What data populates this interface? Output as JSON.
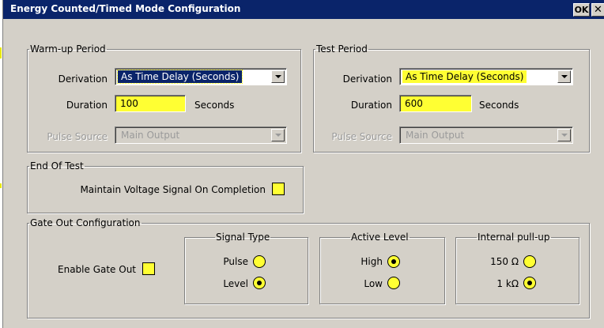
{
  "dialog": {
    "title": "Energy Counted/Timed Mode Configuration",
    "ok_label": "OK",
    "close_label": "✕"
  },
  "warmup": {
    "legend": "Warm-up Period",
    "derivation_label": "Derivation",
    "derivation_value": "As Time Delay (Seconds)",
    "duration_label": "Duration",
    "duration_value": "100",
    "duration_unit": "Seconds",
    "pulse_source_label": "Pulse Source",
    "pulse_source_value": "Main Output"
  },
  "test": {
    "legend": "Test Period",
    "derivation_label": "Derivation",
    "derivation_value": "As Time Delay (Seconds)",
    "duration_label": "Duration",
    "duration_value": "600",
    "duration_unit": "Seconds",
    "pulse_source_label": "Pulse Source",
    "pulse_source_value": "Main Output"
  },
  "end_of_test": {
    "legend": "End Of Test",
    "maintain_label": "Maintain Voltage Signal On Completion",
    "maintain_checked": false
  },
  "gate_out": {
    "legend": "Gate Out Configuration",
    "enable_label": "Enable Gate Out",
    "enable_checked": false,
    "signal_type": {
      "legend": "Signal Type",
      "options": [
        "Pulse",
        "Level"
      ],
      "selected": "Level"
    },
    "active_level": {
      "legend": "Active Level",
      "options": [
        "High",
        "Low"
      ],
      "selected": "High"
    },
    "pullup": {
      "legend": "Internal pull-up",
      "options": [
        "150 Ω",
        "1 kΩ"
      ],
      "selected": "1 kΩ"
    }
  },
  "colors": {
    "titlebar": "#0a246a",
    "dialog_bg": "#d4d0c8",
    "field_highlight": "#ffff33"
  }
}
